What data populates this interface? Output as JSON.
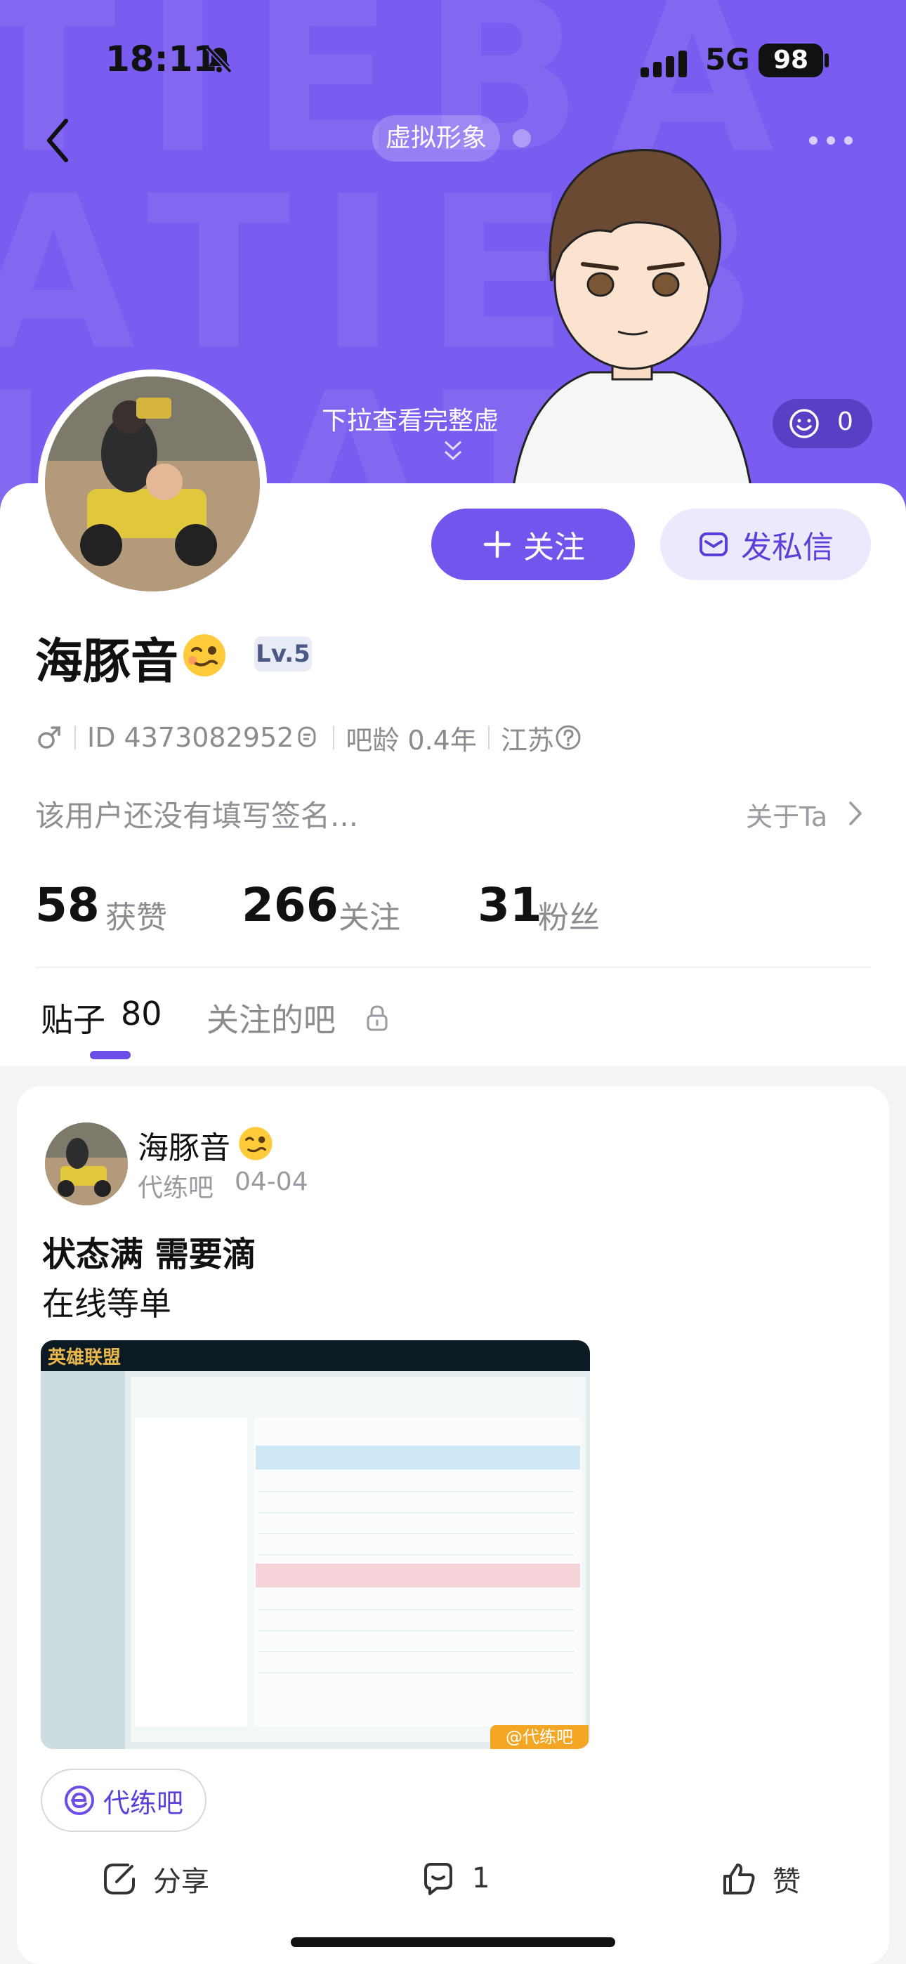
{
  "status_bar": {
    "time": "18:11",
    "network": "5G",
    "battery": "98"
  },
  "header": {
    "avatar_pill": "虚拟形象",
    "pull_hint": "下拉查看完整虚",
    "likes_count": "0"
  },
  "profile": {
    "name": "海豚音",
    "level": "Lv.5",
    "id_text": "ID 4373082952",
    "bar_age": "吧龄 0.4年",
    "location": "江苏",
    "signature": "该用户还没有填写签名...",
    "about_label": "关于Ta",
    "follow_button": "关注",
    "message_button": "发私信"
  },
  "stats": [
    {
      "value": "58",
      "label": "获赞"
    },
    {
      "value": "266",
      "label": "关注"
    },
    {
      "value": "31",
      "label": "粉丝"
    }
  ],
  "tabs": {
    "posts_label": "贴子",
    "posts_count": "80",
    "bars_label": "关注的吧"
  },
  "post": {
    "author": "海豚音",
    "forum": "代练吧",
    "date": "04-04",
    "title": "状态满 需要滴",
    "body": "在线等单",
    "image_logo": "英雄联盟",
    "image_watermark": "@代练吧",
    "forum_tag": "代练吧",
    "share_label": "分享",
    "comment_count": "1",
    "like_label": "赞"
  },
  "colors": {
    "hero": "#7a5cf0",
    "accent": "#7255ec",
    "accent_light": "#ede9fc"
  }
}
